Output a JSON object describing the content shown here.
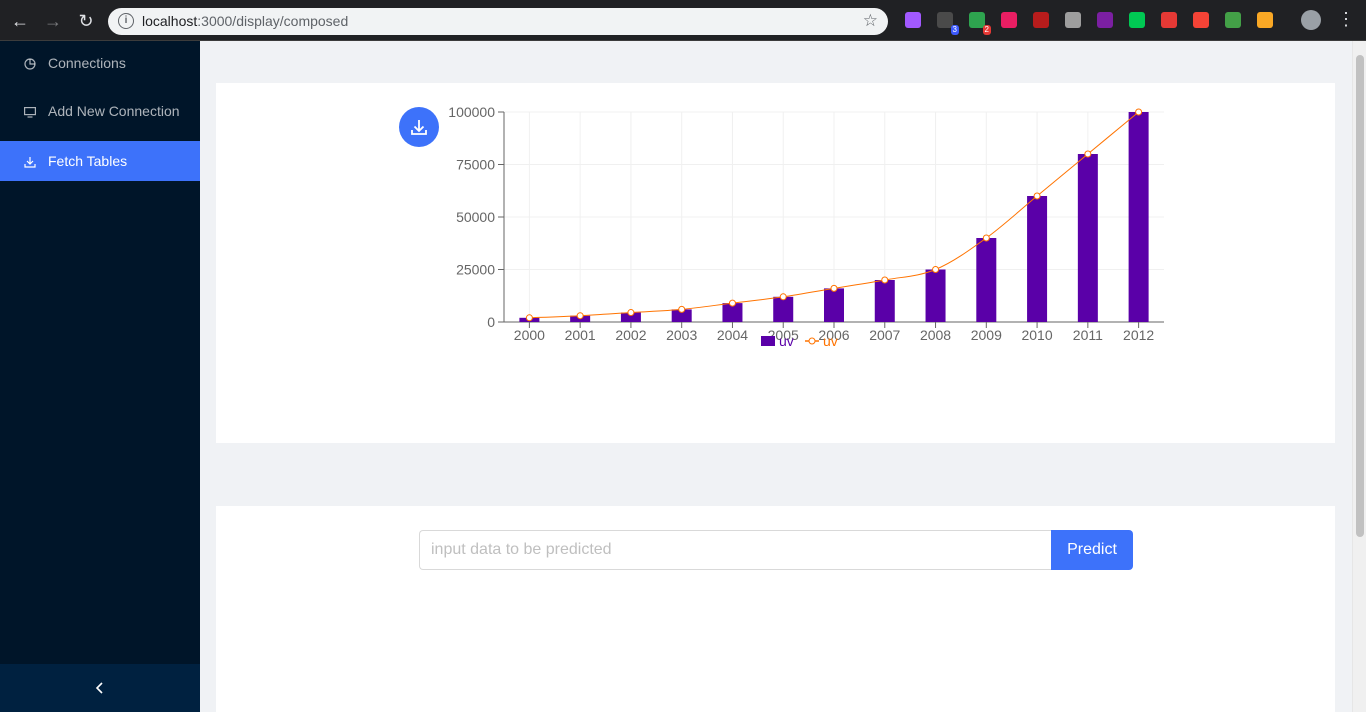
{
  "browser": {
    "url_host": "localhost",
    "url_rest": ":3000/display/composed",
    "extensions": [
      {
        "name": "purple-ext-icon",
        "color": "#a259ff"
      },
      {
        "name": "robot-ext-icon",
        "color": "#4a4a4a",
        "badge": "3",
        "badge_color": "#3d5afe"
      },
      {
        "name": "download-ext-icon",
        "color": "#2ea44f",
        "badge": "2",
        "badge_color": "#e53935"
      },
      {
        "name": "pink-ext-icon",
        "color": "#e91e63"
      },
      {
        "name": "ublock-icon",
        "color": "#b71c1c"
      },
      {
        "name": "camera-icon",
        "color": "#9e9e9e"
      },
      {
        "name": "eyedropper-ext-icon",
        "color": "#7b1fa2"
      },
      {
        "name": "target-ext-icon",
        "color": "#00c853"
      },
      {
        "name": "gear-ext-icon",
        "color": "#e53935"
      },
      {
        "name": "percent-ext-icon",
        "color": "#f44336"
      },
      {
        "name": "cors-ext-icon",
        "color": "#43a047"
      },
      {
        "name": "cookie-ext-icon",
        "color": "#f9a825"
      }
    ]
  },
  "sidebar": {
    "items": [
      {
        "label": "Connections",
        "icon": "pie-chart-icon",
        "active": false
      },
      {
        "label": "Add New Connection",
        "icon": "desktop-icon",
        "active": false
      },
      {
        "label": "Fetch Tables",
        "icon": "download-icon",
        "active": true
      }
    ],
    "collapse_icon": "chevron-left-icon"
  },
  "predict": {
    "placeholder": "input data to be predicted",
    "button_label": "Predict"
  },
  "colors": {
    "accent": "#3d72fa",
    "bar": "#5a00a8",
    "line": "#ff7300"
  },
  "chart_data": {
    "type": "bar",
    "categories": [
      "2000",
      "2001",
      "2002",
      "2003",
      "2004",
      "2005",
      "2006",
      "2007",
      "2008",
      "2009",
      "2010",
      "2011",
      "2012"
    ],
    "series": [
      {
        "name": "uv",
        "type": "bar",
        "values": [
          2000,
          3000,
          4500,
          6000,
          9000,
          12000,
          16000,
          20000,
          25000,
          40000,
          60000,
          80000,
          100000
        ]
      },
      {
        "name": "uv",
        "type": "line",
        "values": [
          2000,
          3000,
          4500,
          6000,
          9000,
          12000,
          16000,
          20000,
          25000,
          40000,
          60000,
          80000,
          100000
        ]
      }
    ],
    "yticks": [
      0,
      25000,
      50000,
      75000,
      100000
    ],
    "ylim": [
      0,
      100000
    ],
    "grid": true,
    "legend": "bottom"
  }
}
